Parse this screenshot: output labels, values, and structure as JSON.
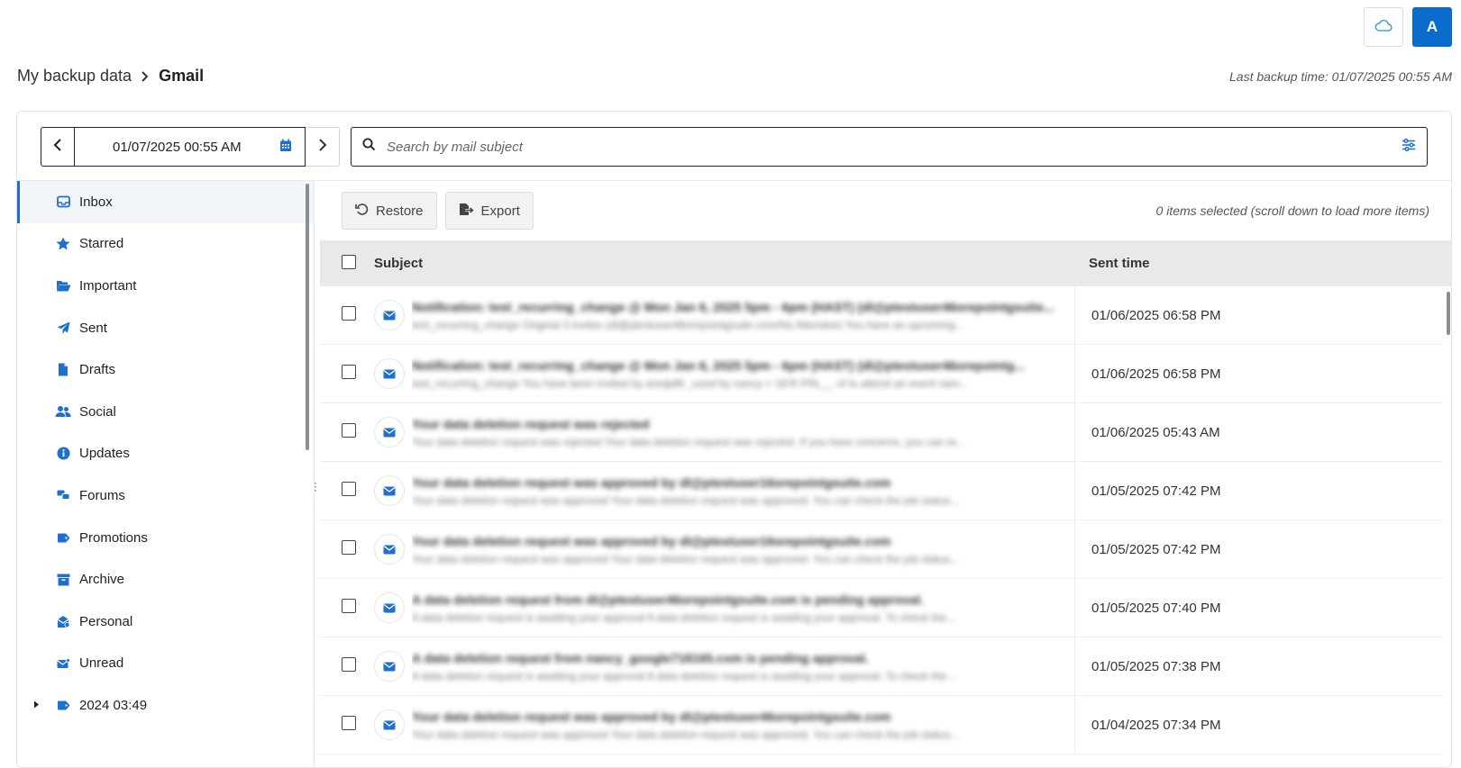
{
  "topbar": {
    "cloud_icon": "cloud-icon",
    "avatar_letter": "A",
    "accent_color": "#0c6ccd"
  },
  "breadcrumb": {
    "root": "My backup data",
    "current": "Gmail"
  },
  "last_backup": "Last backup time: 01/07/2025 00:55 AM",
  "date_picker": {
    "value": "01/07/2025 00:55 AM"
  },
  "search": {
    "placeholder": "Search by mail subject"
  },
  "sidebar": {
    "items": [
      {
        "label": "Inbox",
        "icon": "inbox-icon",
        "active": true
      },
      {
        "label": "Starred",
        "icon": "star-icon"
      },
      {
        "label": "Important",
        "icon": "folder-open-icon"
      },
      {
        "label": "Sent",
        "icon": "paper-plane-icon"
      },
      {
        "label": "Drafts",
        "icon": "file-icon"
      },
      {
        "label": "Social",
        "icon": "users-icon"
      },
      {
        "label": "Updates",
        "icon": "info-icon"
      },
      {
        "label": "Forums",
        "icon": "chat-icon"
      },
      {
        "label": "Promotions",
        "icon": "tag-icon"
      },
      {
        "label": "Archive",
        "icon": "archive-icon"
      },
      {
        "label": "Personal",
        "icon": "personal-mail-icon"
      },
      {
        "label": "Unread",
        "icon": "unread-mail-icon"
      },
      {
        "label": "2024 03:49",
        "icon": "tag-icon",
        "expandable": true
      }
    ]
  },
  "actions": {
    "restore_label": "Restore",
    "export_label": "Export",
    "selected_info": "0 items selected (scroll down to load more items)"
  },
  "table": {
    "col_subject": "Subject",
    "col_sent": "Sent time",
    "rows": [
      {
        "subject": "Notification: test_recurring_change @ Mon Jan 6, 2025 5pm - 6pm (HAST) (dl@ptestuser46orepointgsuite...",
        "preview": "test_recurring_change Original 3 invites (dl@ptestuser46orepointgsuite.com/No Attendee) You have an upcoming...",
        "sent": "01/06/2025 06:58 PM"
      },
      {
        "subject": "Notification: test_recurring_change @ Mon Jan 6, 2025 5pm - 6pm (HAST) (dl@ptestuser46orepointg...",
        "preview": "test_recurring_change You have been invited by aredpfill _used by nancy > 18:R PIN__. of to attend an event nam...",
        "sent": "01/06/2025 06:58 PM"
      },
      {
        "subject": "Your data deletion request was rejected",
        "preview": "Your data deletion request was rejected Your data deletion request was rejected. If you have concerns, you can re...",
        "sent": "01/06/2025 05:43 AM"
      },
      {
        "subject": "Your data deletion request was approved by dl@ptestuser16orepointgsuite.com",
        "preview": "Your data deletion request was approved Your data deletion request was approved. You can check the job status...",
        "sent": "01/05/2025 07:42 PM"
      },
      {
        "subject": "Your data deletion request was approved by dl@ptestuser16orepointgsuite.com",
        "preview": "Your data deletion request was approved Your data deletion request was approved. You can check the job status...",
        "sent": "01/05/2025 07:42 PM"
      },
      {
        "subject": "A data deletion request from dl@ptestuser46orepointgsuite.com is pending approval.",
        "preview": "A data deletion request is awaiting your approval A data deletion request is awaiting your approval. To check the...",
        "sent": "01/05/2025 07:40 PM"
      },
      {
        "subject": "A data deletion request from nancy_google718165.com is pending approval.",
        "preview": "A data deletion request is awaiting your approval A data deletion request is awaiting your approval. To check the...",
        "sent": "01/05/2025 07:38 PM"
      },
      {
        "subject": "Your data deletion request was approved by dl@ptestuser46orepointgsuite.com",
        "preview": "Your data deletion request was approved Your data deletion request was approved. You can check the job status...",
        "sent": "01/04/2025 07:34 PM"
      }
    ]
  }
}
